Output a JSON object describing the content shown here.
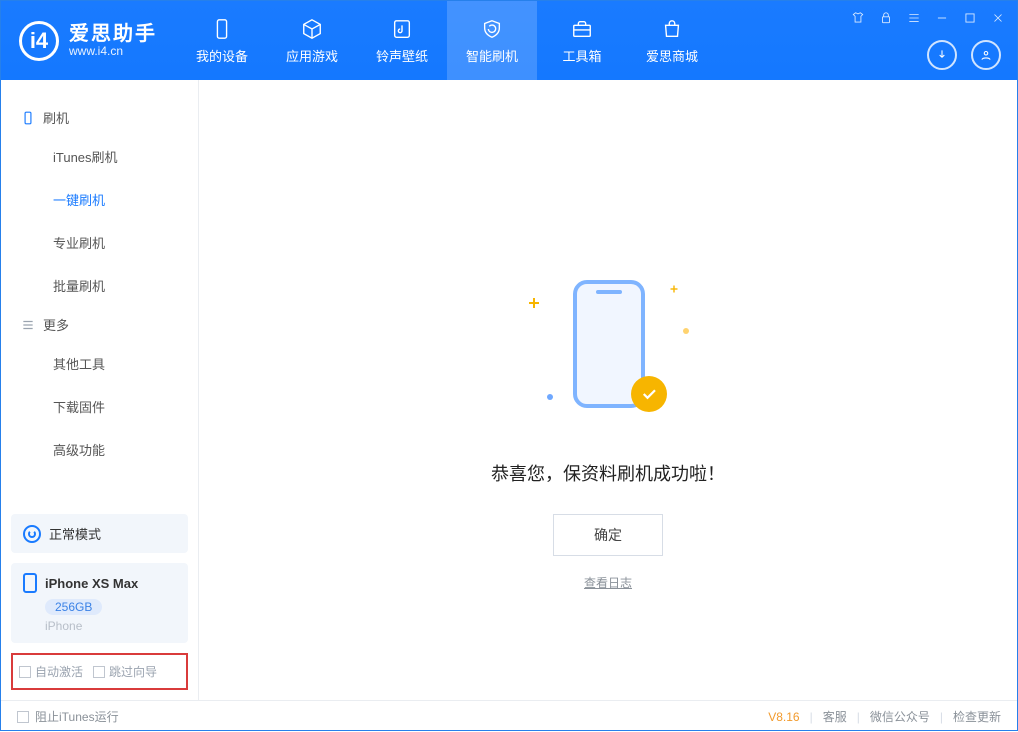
{
  "app": {
    "name": "爱思助手",
    "site": "www.i4.cn"
  },
  "nav": {
    "items": [
      {
        "label": "我的设备"
      },
      {
        "label": "应用游戏"
      },
      {
        "label": "铃声壁纸"
      },
      {
        "label": "智能刷机"
      },
      {
        "label": "工具箱"
      },
      {
        "label": "爱思商城"
      }
    ],
    "activeIndex": 3
  },
  "sidebar": {
    "sections": [
      {
        "title": "刷机",
        "items": [
          "iTunes刷机",
          "一键刷机",
          "专业刷机",
          "批量刷机"
        ],
        "activeIndex": 1
      },
      {
        "title": "更多",
        "items": [
          "其他工具",
          "下载固件",
          "高级功能"
        ],
        "activeIndex": -1
      }
    ],
    "mode": "正常模式",
    "device": {
      "name": "iPhone XS Max",
      "storage": "256GB",
      "type": "iPhone"
    },
    "checks": {
      "autoActivate": "自动激活",
      "skipGuide": "跳过向导"
    }
  },
  "main": {
    "successText": "恭喜您，保资料刷机成功啦！",
    "okButton": "确定",
    "logLink": "查看日志"
  },
  "footer": {
    "blockItunes": "阻止iTunes运行",
    "version": "V8.16",
    "links": [
      "客服",
      "微信公众号",
      "检查更新"
    ]
  }
}
